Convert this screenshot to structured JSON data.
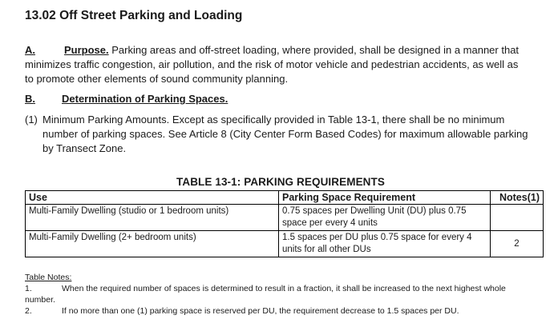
{
  "section": {
    "title": "13.02  Off Street Parking and Loading"
  },
  "para_a": {
    "label": "A.",
    "lead": "Purpose.",
    "line1": " Parking areas and off-street loading, where provided, shall be designed in a manner that",
    "line2": "minimizes traffic congestion, air pollution, and the risk of motor vehicle and pedestrian accidents, as well as",
    "line3": "to promote other elements of sound community planning."
  },
  "para_b": {
    "label": "B.",
    "heading": "Determination of Parking Spaces."
  },
  "item_1": {
    "number": "(1)",
    "line1": "Minimum Parking Amounts. Except as specifically provided in Table 13-1, there shall be no minimum",
    "line2": "number of parking spaces. See Article 8 (City Center Form Based Codes) for maximum allowable parking",
    "line3": "by Transect Zone."
  },
  "table": {
    "title": "TABLE 13-1:  PARKING REQUIREMENTS",
    "headers": [
      "Use",
      "Parking Space Requirement",
      "Notes(1)"
    ],
    "rows": [
      {
        "use": "Multi-Family Dwelling (studio or 1 bedroom units)",
        "req_line1": "0.75 spaces per Dwelling Unit (DU) plus 0.75",
        "req_line2": "space per every 4 units",
        "note": ""
      },
      {
        "use": "Multi-Family Dwelling (2+ bedroom units)",
        "req_line1": "1.5 spaces per DU plus 0.75 space for every 4",
        "req_line2": "units for all other DUs",
        "note": "2"
      }
    ]
  },
  "notes": {
    "heading": "Table Notes:",
    "items": [
      {
        "num": "1.",
        "text": "When the required number of spaces is determined to result in a fraction, it shall be increased to the next highest whole",
        "cont": "number."
      },
      {
        "num": "2.",
        "text": "If no more than one (1) parking space is reserved per DU, the requirement decrease to 1.5 spaces per DU."
      }
    ]
  }
}
